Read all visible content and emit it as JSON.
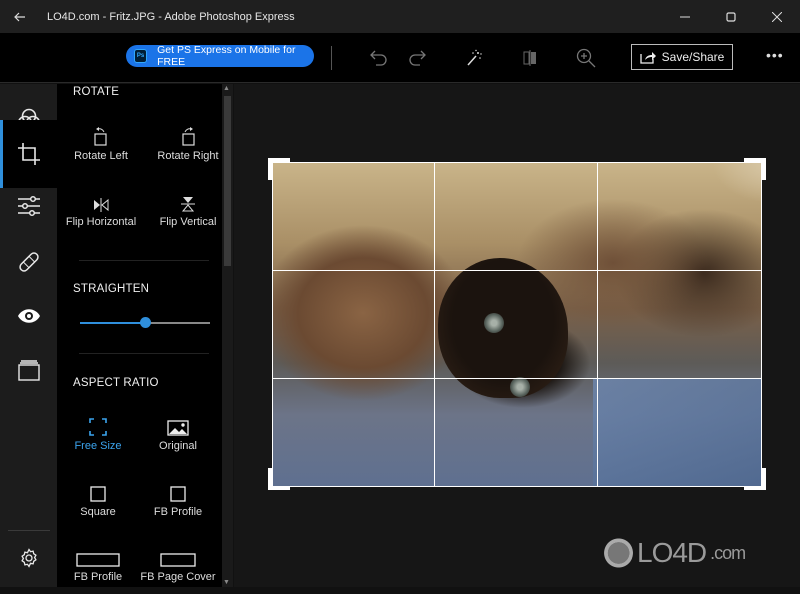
{
  "window": {
    "title": "LO4D.com - Fritz.JPG - Adobe Photoshop Express",
    "back_icon": "arrow-left-icon",
    "minimize_icon": "minimize-icon",
    "maximize_icon": "maximize-icon",
    "close_icon": "close-icon"
  },
  "toolbar": {
    "promo_badge": "Ps",
    "promo_label": "Get PS Express on Mobile for FREE",
    "undo_icon": "undo-icon",
    "redo_icon": "redo-icon",
    "auto_fix_icon": "magic-wand-icon",
    "compare_icon": "compare-icon",
    "zoom_icon": "zoom-in-icon",
    "save_label": "Save/Share",
    "more_label": "•••"
  },
  "rail": {
    "items": [
      {
        "name": "looks",
        "icon": "color-circles-icon",
        "active": false
      },
      {
        "name": "crop",
        "icon": "crop-icon",
        "active": true
      },
      {
        "name": "adjustments",
        "icon": "sliders-icon",
        "active": false
      },
      {
        "name": "healing",
        "icon": "bandage-icon",
        "active": false
      },
      {
        "name": "red-eye",
        "icon": "eye-icon",
        "active": false
      },
      {
        "name": "borders",
        "icon": "layers-icon",
        "active": false
      }
    ],
    "settings_icon": "gear-icon"
  },
  "panel": {
    "rotate": {
      "title": "ROTATE",
      "tools": [
        {
          "label": "Rotate Left",
          "icon": "rotate-left-icon"
        },
        {
          "label": "Rotate Right",
          "icon": "rotate-right-icon"
        },
        {
          "label": "Flip Horizontal",
          "icon": "flip-horizontal-icon"
        },
        {
          "label": "Flip Vertical",
          "icon": "flip-vertical-icon"
        }
      ]
    },
    "straighten": {
      "title": "STRAIGHTEN",
      "value_fraction": 0.5
    },
    "aspect_ratio": {
      "title": "ASPECT RATIO",
      "options": [
        {
          "label": "Free Size",
          "icon": "free-size-icon",
          "selected": true
        },
        {
          "label": "Original",
          "icon": "image-icon",
          "selected": false
        },
        {
          "label": "Square",
          "icon": "square-icon",
          "selected": false
        },
        {
          "label": "FB Profile",
          "icon": "square-icon",
          "selected": false
        },
        {
          "label": "FB Profile",
          "icon": "wide-rect-icon",
          "selected": false
        },
        {
          "label": "FB Page Cover",
          "icon": "wide-rect-icon",
          "selected": false
        }
      ]
    }
  },
  "canvas": {
    "image_alt": "Siamese cat lying on a rug",
    "crop_grid": "rule-of-thirds"
  },
  "watermark": {
    "text": "LO4D",
    "suffix": ".com"
  },
  "colors": {
    "accent": "#2f8fdc",
    "promo": "#1b74e8",
    "background": "#161616"
  }
}
